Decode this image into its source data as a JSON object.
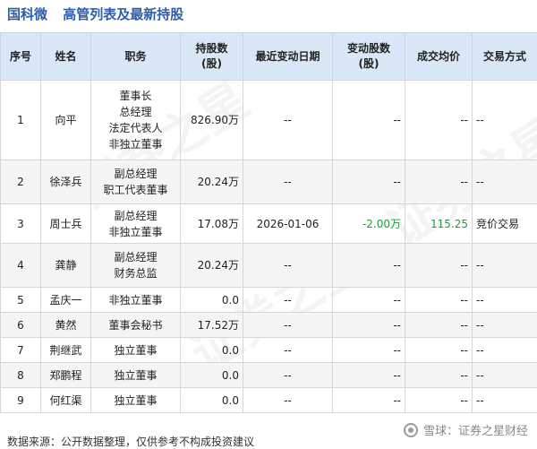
{
  "header": {
    "company": "国科微",
    "title": "高管列表及最新持股"
  },
  "table": {
    "columns": [
      "序号",
      "姓名",
      "职务",
      "持股数\n(股)",
      "最近变动日期",
      "变动股数\n(股)",
      "成交均价",
      "交易方式"
    ],
    "rows": [
      {
        "no": "1",
        "name": "向平",
        "roles": [
          "董事长",
          "总经理",
          "法定代表人",
          "非独立董事"
        ],
        "shares": "826.90万",
        "date": "--",
        "change": "--",
        "price": "--",
        "method": "--"
      },
      {
        "no": "2",
        "name": "徐泽兵",
        "roles": [
          "副总经理",
          "职工代表董事"
        ],
        "shares": "20.24万",
        "date": "--",
        "change": "--",
        "price": "--",
        "method": "--"
      },
      {
        "no": "3",
        "name": "周士兵",
        "roles": [
          "副总经理",
          "非独立董事"
        ],
        "shares": "17.08万",
        "date": "2026-01-06",
        "change": "-2.00万",
        "price": "115.25",
        "method": "竞价交易"
      },
      {
        "no": "4",
        "name": "龚静",
        "roles": [
          "副总经理",
          "财务总监"
        ],
        "shares": "20.24万",
        "date": "--",
        "change": "--",
        "price": "--",
        "method": "--"
      },
      {
        "no": "5",
        "name": "孟庆一",
        "roles": [
          "非独立董事"
        ],
        "shares": "0.0",
        "date": "--",
        "change": "--",
        "price": "--",
        "method": "--"
      },
      {
        "no": "6",
        "name": "黄然",
        "roles": [
          "董事会秘书"
        ],
        "shares": "17.52万",
        "date": "--",
        "change": "--",
        "price": "--",
        "method": "--"
      },
      {
        "no": "7",
        "name": "荆继武",
        "roles": [
          "独立董事"
        ],
        "shares": "0.0",
        "date": "--",
        "change": "--",
        "price": "--",
        "method": "--"
      },
      {
        "no": "8",
        "name": "郑鹏程",
        "roles": [
          "独立董事"
        ],
        "shares": "0.0",
        "date": "--",
        "change": "--",
        "price": "--",
        "method": "--"
      },
      {
        "no": "9",
        "name": "何红渠",
        "roles": [
          "独立董事"
        ],
        "shares": "0.0",
        "date": "--",
        "change": "--",
        "price": "--",
        "method": "--"
      }
    ]
  },
  "footer": {
    "source": "数据来源：公开数据整理，仅供参考不构成投资建议",
    "brand": "雪球：证券之星财经"
  },
  "colors": {
    "title": "#2f5da8",
    "header_bg": "#d9e7f7",
    "change_green": "#1a9e3a"
  }
}
